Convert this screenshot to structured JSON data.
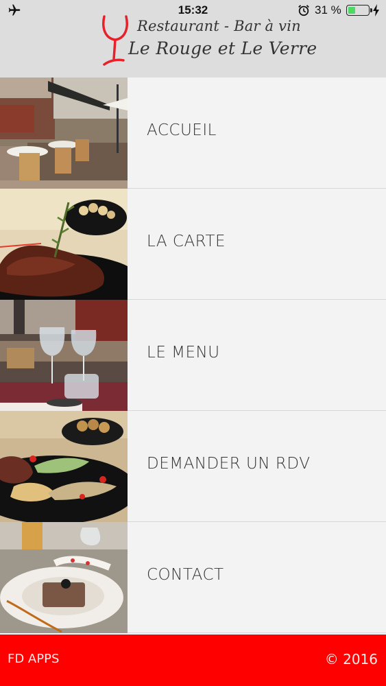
{
  "status_bar": {
    "time": "15:32",
    "battery_percent_text": "31 %",
    "battery_level": 0.31,
    "icons": [
      "airplane-icon",
      "alarm-icon",
      "battery-icon",
      "charging-bolt-icon"
    ]
  },
  "header": {
    "logo_line1": "Restaurant - Bar à vin",
    "logo_line2": "Le Rouge  et Le Verre",
    "logo_color": "#e8202a"
  },
  "menu": {
    "items": [
      {
        "label": "ACCUEIL",
        "image": "restaurant-terrace-photo"
      },
      {
        "label": "LA CARTE",
        "image": "steak-dish-photo"
      },
      {
        "label": "LE MENU",
        "image": "wine-glasses-table-photo"
      },
      {
        "label": "DEMANDER UN RDV",
        "image": "plated-dish-photo"
      },
      {
        "label": "CONTACT",
        "image": "dessert-plate-photo"
      }
    ]
  },
  "footer": {
    "left": "FD APPS",
    "right": "© 2016",
    "background": "#ff0000"
  }
}
